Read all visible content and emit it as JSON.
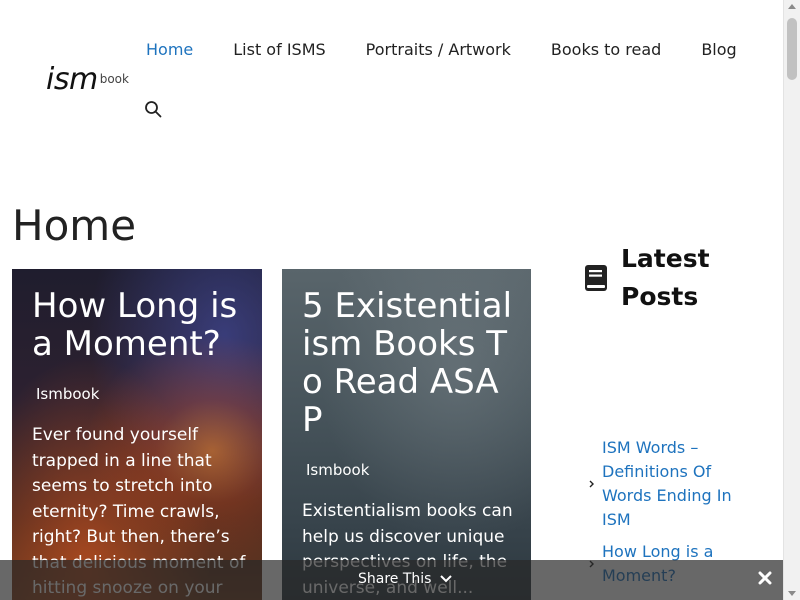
{
  "site": {
    "logo_main": "ism",
    "logo_sub": "book"
  },
  "nav": {
    "items": [
      {
        "label": "Home",
        "active": true
      },
      {
        "label": "List of ISMS"
      },
      {
        "label": "Portraits / Artwork"
      },
      {
        "label": "Books to read"
      },
      {
        "label": "Blog"
      }
    ],
    "search_icon": "search-icon"
  },
  "page": {
    "title": "Home"
  },
  "cards": [
    {
      "title": "How Long is a Moment?",
      "author": "Ismbook",
      "excerpt": "Ever found yourself trapped in a line that seems to stretch into eternity? Time crawls, right? But then, there’s that delicious moment of hitting snooze on your"
    },
    {
      "title": "5 Existentialism Books To Read ASAP",
      "author": "Ismbook",
      "excerpt": "Existentialism books can help us discover unique perspectives on life, the universe, and well..."
    }
  ],
  "sidebar": {
    "title": "Latest Posts",
    "icon": "book-icon",
    "posts": [
      {
        "label": "ISM Words – Definitions Of Words Ending In ISM"
      },
      {
        "label": "How Long is a Moment?"
      }
    ]
  },
  "share": {
    "label": "Share This",
    "close_icon": "close-icon"
  },
  "colors": {
    "link": "#1e73be",
    "text": "#222222",
    "share_bar": "#282828"
  }
}
